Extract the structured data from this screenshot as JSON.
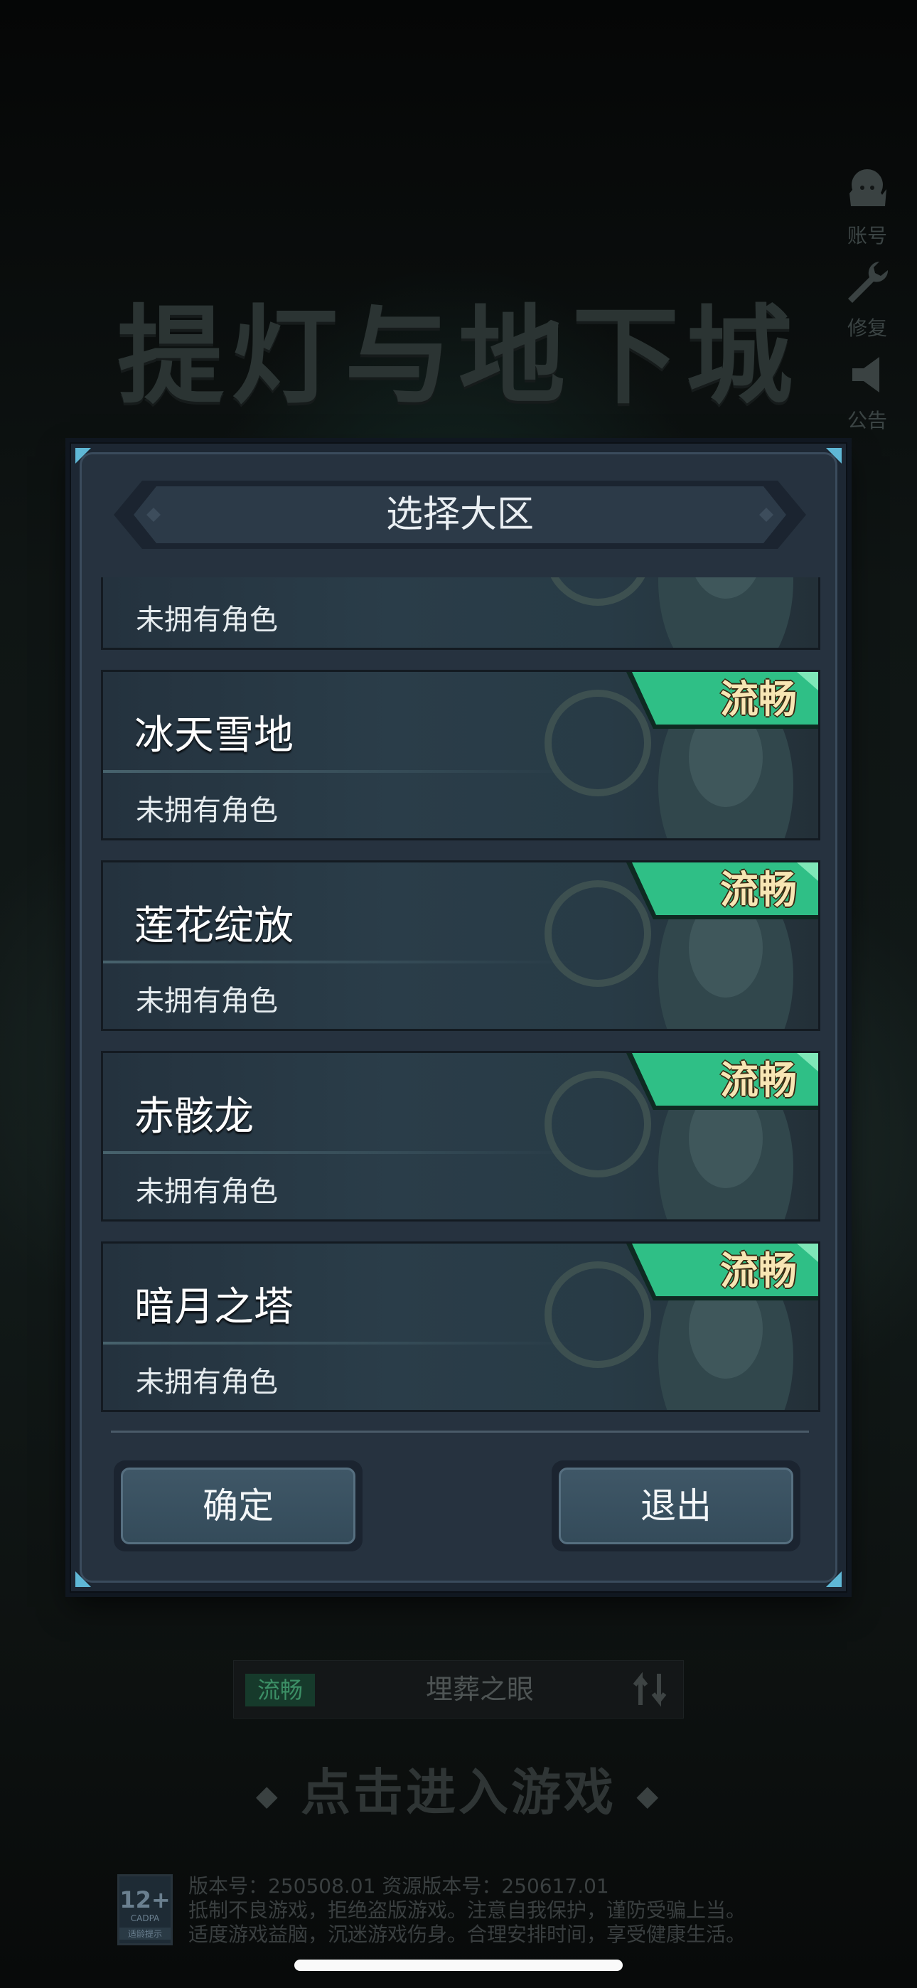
{
  "game": {
    "title": "提灯与地下城"
  },
  "side_menu": [
    {
      "label": "账号",
      "icon": "account-icon"
    },
    {
      "label": "修复",
      "icon": "wrench-icon"
    },
    {
      "label": "公告",
      "icon": "megaphone-icon"
    }
  ],
  "dialog": {
    "title": "选择大区",
    "partial_row": {
      "owned_text": "未拥有角色"
    },
    "servers": [
      {
        "name": "冰天雪地",
        "status": "流畅",
        "owned_text": "未拥有角色"
      },
      {
        "name": "莲花绽放",
        "status": "流畅",
        "owned_text": "未拥有角色"
      },
      {
        "name": "赤骸龙",
        "status": "流畅",
        "owned_text": "未拥有角色"
      },
      {
        "name": "暗月之塔",
        "status": "流畅",
        "owned_text": "未拥有角色"
      }
    ],
    "confirm_label": "确定",
    "exit_label": "退出"
  },
  "current_server": {
    "status": "流畅",
    "name": "埋葬之眼"
  },
  "enter_game": "点击进入游戏",
  "legal": {
    "age_rating": "12+",
    "rating_org": "CADPA",
    "rating_tip": "适龄提示",
    "version_line": "版本号：250508.01  资源版本号：250617.01",
    "line2": "抵制不良游戏，拒绝盗版游戏。注意自我保护，谨防受骗上当。",
    "line3": "适度游戏益脑，沉迷游戏伤身。合理安排时间，享受健康生活。"
  },
  "colors": {
    "dialog_bg": "#26323f",
    "badge_green": "#2fbf86",
    "badge_text": "#f7e6b4"
  }
}
